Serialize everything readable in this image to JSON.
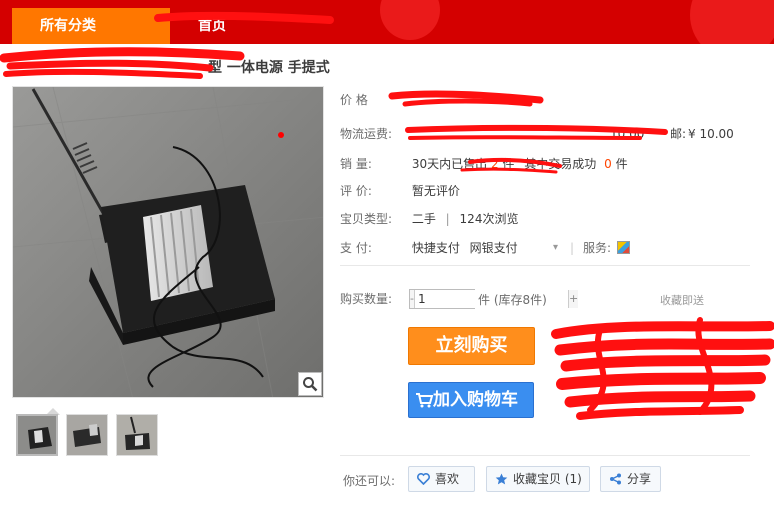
{
  "nav": {
    "category_label": "所有分类",
    "home_label": "首页"
  },
  "product": {
    "title": "型 一体电源 手提式"
  },
  "price": {
    "label": "价      格",
    "value": ""
  },
  "shipping": {
    "label": "物流运费:",
    "partial": "10.00",
    "express_label": "邮:",
    "express_value": "¥ 10.00"
  },
  "sales": {
    "label": "销      量:",
    "prefix": "30天内已售出",
    "count": "2",
    "unit": "件",
    "deal_prefix": "其中交易成功",
    "deal_count": "0",
    "deal_unit": "件"
  },
  "reviews": {
    "label": "评      价:",
    "value": "暂无评价"
  },
  "type": {
    "label": "宝贝类型:",
    "value": "二手",
    "views": "124次浏览"
  },
  "payment": {
    "label": "支      付:",
    "method1": "快捷支付",
    "method2": "网银支付",
    "service_label": "服务:"
  },
  "quantity": {
    "label": "购买数量:",
    "value": "1",
    "minus": "-",
    "plus": "+",
    "unit": "件 (库存8件)",
    "hint": "收藏即送"
  },
  "actions": {
    "buy_now": "立刻购买",
    "add_to_cart": "加入购物车"
  },
  "social": {
    "label": "你还可以:",
    "like": "喜欢",
    "collect": "收藏宝贝 (1)",
    "share": "分享"
  },
  "colors": {
    "nav_red": "#d40000",
    "category_orange": "#ff7700",
    "buy_orange": "#ff8e1c",
    "cart_blue": "#3a8ef0",
    "accent": "#ff4400"
  },
  "icons": {
    "zoom": "magnifier-icon",
    "cart": "cart-icon",
    "like": "heart-icon",
    "collect": "star-icon",
    "share": "share-icon",
    "service": "service-badge-icon"
  }
}
